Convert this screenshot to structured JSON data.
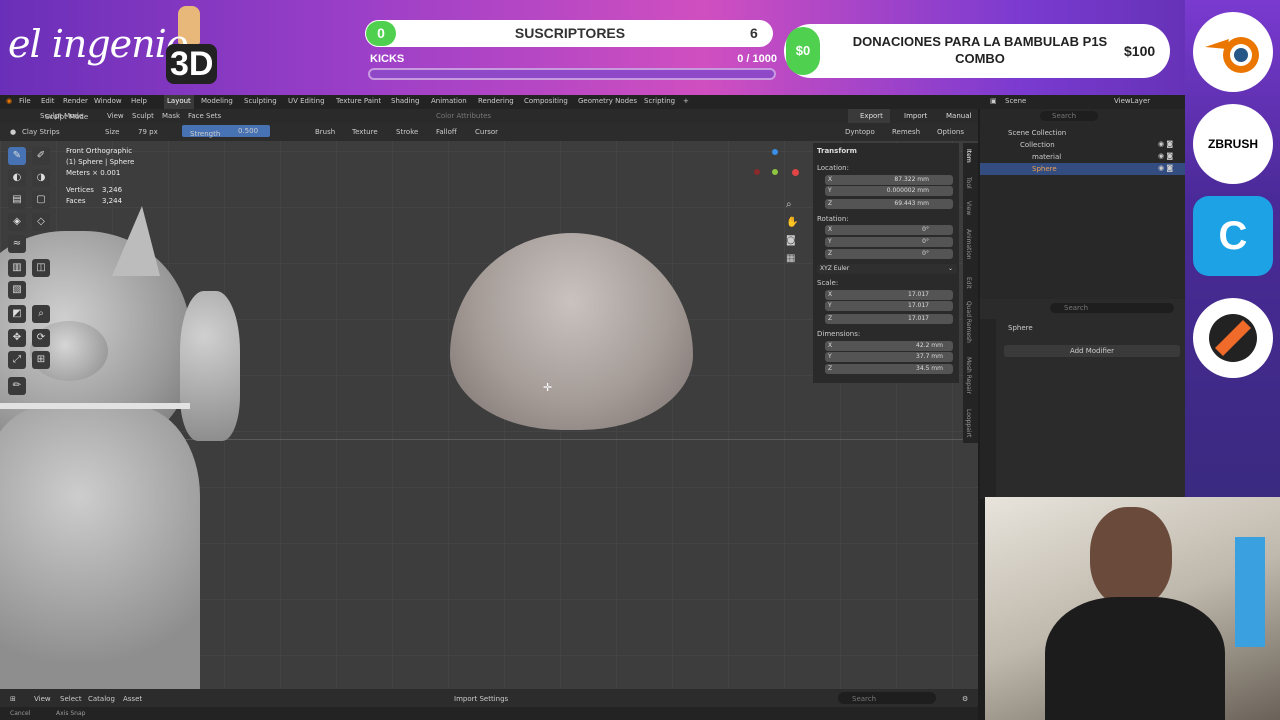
{
  "overlay": {
    "brand_text": "el ingenio",
    "brand_3d": "3D",
    "subs": {
      "count": "0",
      "label": "SUSCRIPTORES",
      "goal": "6"
    },
    "kicks": {
      "label": "KICKS",
      "value": "0 / 1000",
      "progress": 0
    },
    "donations": {
      "amount": "$0",
      "label": "DONACIONES PARA LA BAMBULAB P1S COMBO",
      "goal": "$100"
    },
    "side_logos": [
      "blender-logo",
      "ZBRUSH",
      "C",
      "pointer-logo"
    ]
  },
  "topbar": {
    "menus": [
      "File",
      "Edit",
      "Render",
      "Window",
      "Help"
    ],
    "workspaces": [
      "Layout",
      "Modeling",
      "Sculpting",
      "UV Editing",
      "Texture Paint",
      "Shading",
      "Animation",
      "Rendering",
      "Compositing",
      "Geometry Nodes",
      "Scripting",
      "+"
    ],
    "scene": "Scene",
    "view_layer": "ViewLayer"
  },
  "header": {
    "color_attributes": "Color Attributes",
    "export": "Export",
    "import": "Import",
    "manual": "Manual"
  },
  "toolsettings": {
    "brush": "Clay Strips",
    "mode": "Sculpt Mode",
    "menus": [
      "View",
      "Sculpt",
      "Mask",
      "Face Sets"
    ],
    "size_label": "Size",
    "size_value": "79 px",
    "strength_label": "Strength",
    "strength_value": "0.500",
    "dropdowns": [
      "Brush",
      "Texture",
      "Stroke",
      "Falloff",
      "Cursor"
    ],
    "dyntopo": "Dyntopo",
    "remesh": "Remesh",
    "options": "Options"
  },
  "viewport": {
    "view_name": "Front Orthographic",
    "object": "(1) Sphere | Sphere",
    "scale": "Meters × 0.001",
    "vertices_label": "Vertices",
    "vertices": "3,246",
    "faces_label": "Faces",
    "faces": "3,244"
  },
  "npanel": {
    "transform": "Transform",
    "location_label": "Location:",
    "location": [
      {
        "k": "X",
        "v": "87.322 mm"
      },
      {
        "k": "Y",
        "v": "0.000002 mm"
      },
      {
        "k": "Z",
        "v": "69.443 mm"
      }
    ],
    "rotation_label": "Rotation:",
    "rotation": [
      {
        "k": "X",
        "v": "0°"
      },
      {
        "k": "Y",
        "v": "0°"
      },
      {
        "k": "Z",
        "v": "0°"
      }
    ],
    "rotation_mode": "XYZ Euler",
    "scale_label": "Scale:",
    "scale": [
      {
        "k": "X",
        "v": "17.017"
      },
      {
        "k": "Y",
        "v": "17.017"
      },
      {
        "k": "Z",
        "v": "17.017"
      }
    ],
    "dimensions_label": "Dimensions:",
    "dimensions": [
      {
        "k": "X",
        "v": "42.2 mm"
      },
      {
        "k": "Y",
        "v": "37.7 mm"
      },
      {
        "k": "Z",
        "v": "34.5 mm"
      }
    ],
    "tabs": [
      "Item",
      "Tool",
      "View",
      "Animation",
      "Edit",
      "Quad Remesh",
      "Mesh Repair",
      "Looppairt"
    ]
  },
  "outliner": {
    "search_placeholder": "Search",
    "rows": [
      "Scene Collection",
      "Collection",
      "material",
      "Sphere"
    ]
  },
  "properties": {
    "search_placeholder": "Search",
    "object": "Sphere",
    "add_modifier": "Add Modifier"
  },
  "bottombar": {
    "menus": [
      "View",
      "Select",
      "Catalog",
      "Asset"
    ],
    "import_settings": "Import Settings",
    "search_placeholder": "Search"
  },
  "status": {
    "cancel": "Cancel",
    "axis_snap": "Axis Snap"
  }
}
